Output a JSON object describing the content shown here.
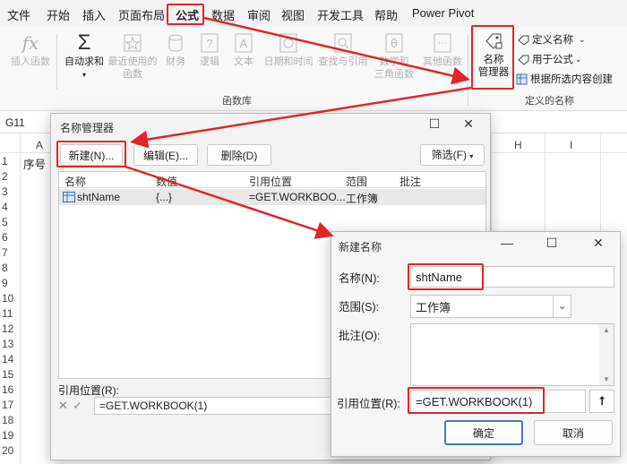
{
  "menu": [
    "文件",
    "开始",
    "插入",
    "页面布局",
    "公式",
    "数据",
    "审阅",
    "视图",
    "开发工具",
    "帮助",
    "Power Pivot"
  ],
  "ribbon": {
    "insert_function": "插入函数",
    "autosum_line1": "自动求和",
    "recent_line1": "最近使用的",
    "recent_line2": "函数",
    "finance": "财务",
    "logic": "逻辑",
    "text": "文本",
    "datetime": "日期和时间",
    "lookup": "查找与引用",
    "math_line1": "数学和",
    "math_line2": "三角函数",
    "other": "其他函数",
    "group_function_library": "函数库",
    "name_manager_line1": "名称",
    "name_manager_line2": "管理器",
    "define_name": "定义名称",
    "use_in_formula": "用于公式",
    "create_from_selection": "根据所选内容创建",
    "group_defined_names": "定义的名称"
  },
  "formula_bar": {
    "cell_ref": "G11"
  },
  "sheet": {
    "columns": [
      "A",
      "H",
      "I"
    ],
    "rows": [
      "1",
      "2",
      "3",
      "4",
      "5",
      "6",
      "7",
      "8",
      "9",
      "10",
      "11",
      "12",
      "13",
      "14",
      "15",
      "16",
      "17",
      "18",
      "19",
      "20"
    ],
    "a1_value": "序号"
  },
  "name_manager": {
    "title": "名称管理器",
    "new_btn": "新建(N)...",
    "edit_btn": "编辑(E)...",
    "delete_btn": "删除(D)",
    "filter_btn": "筛选(F)",
    "headers": [
      "名称",
      "数值",
      "引用位置",
      "范围",
      "批注"
    ],
    "rows": [
      {
        "name": "shtName",
        "value": "{...}",
        "refers": "=GET.WORKBOO...",
        "scope": "工作簿",
        "comment": ""
      }
    ],
    "refers_label": "引用位置(R):",
    "refers_value": "=GET.WORKBOOK(1)"
  },
  "new_name": {
    "title": "新建名称",
    "name_label": "名称(N):",
    "name_value": "shtName",
    "scope_label": "范围(S):",
    "scope_value": "工作簿",
    "comment_label": "批注(O):",
    "refers_label": "引用位置(R):",
    "refers_value": "=GET.WORKBOOK(1)",
    "ok": "确定",
    "cancel": "取消"
  },
  "colors": {
    "highlight": "#e0262b",
    "accent": "#4a78c4"
  }
}
